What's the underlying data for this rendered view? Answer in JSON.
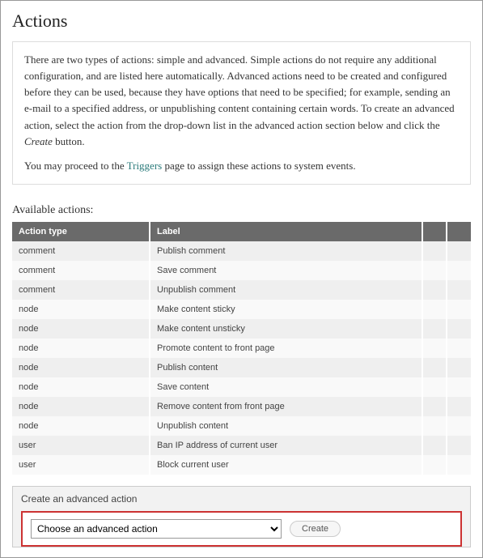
{
  "page_title": "Actions",
  "info_paragraph_1_a": "There are two types of actions: simple and advanced. Simple actions do not require any additional configuration, and are listed here automatically. Advanced actions need to be created and configured before they can be used, because they have options that need to be specified; for example, sending an e-mail to a specified address, or unpublishing content containing certain words. To create an advanced action, select the action from the drop-down list in the advanced action section below and click the ",
  "info_paragraph_1_em": "Create",
  "info_paragraph_1_b": " button.",
  "info_paragraph_2_a": "You may proceed to the ",
  "info_link_triggers": "Triggers",
  "info_paragraph_2_b": " page to assign these actions to system events.",
  "available_label": "Available actions:",
  "table": {
    "headers": {
      "type": "Action type",
      "label": "Label"
    },
    "rows": [
      {
        "type": "comment",
        "label": "Publish comment"
      },
      {
        "type": "comment",
        "label": "Save comment"
      },
      {
        "type": "comment",
        "label": "Unpublish comment"
      },
      {
        "type": "node",
        "label": "Make content sticky"
      },
      {
        "type": "node",
        "label": "Make content unsticky"
      },
      {
        "type": "node",
        "label": "Promote content to front page"
      },
      {
        "type": "node",
        "label": "Publish content"
      },
      {
        "type": "node",
        "label": "Save content"
      },
      {
        "type": "node",
        "label": "Remove content from front page"
      },
      {
        "type": "node",
        "label": "Unpublish content"
      },
      {
        "type": "user",
        "label": "Ban IP address of current user"
      },
      {
        "type": "user",
        "label": "Block current user"
      }
    ]
  },
  "advanced": {
    "title": "Create an advanced action",
    "select_option": "Choose an advanced action",
    "create_button": "Create"
  }
}
